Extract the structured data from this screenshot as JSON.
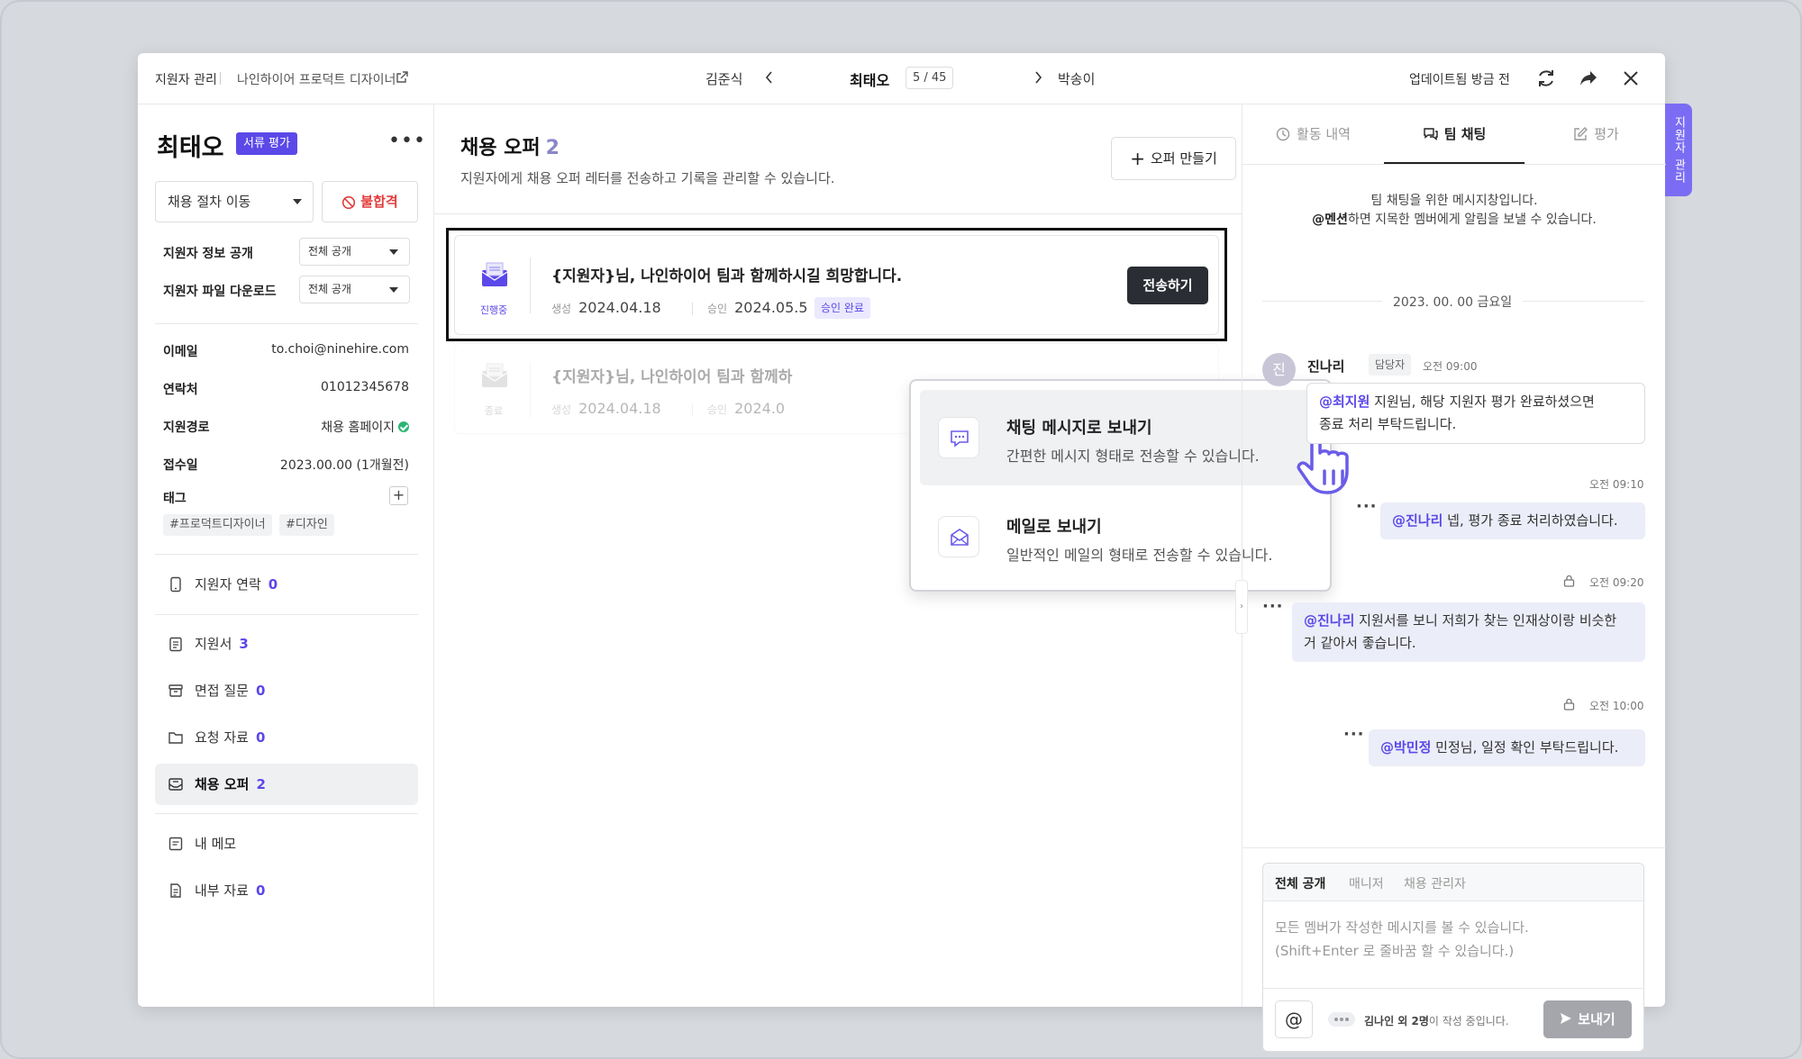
{
  "topbar": {
    "breadcrumb_section": "지원자 관리",
    "breadcrumb_job": "나인하이어 프로덕트 디자이너",
    "prev_candidate": "김준식",
    "current_candidate": "최태오",
    "pager": "5 / 45",
    "next_candidate": "박송이",
    "updated_text": "업데이트됨 방금 전"
  },
  "side_tab": "지원자 관리",
  "candidate": {
    "name": "최태오",
    "stage": "서류 평가",
    "move_stage_label": "채용 절차 이동",
    "reject_label": "불합격",
    "info_disclosure_label": "지원자 정보 공개",
    "info_disclosure_value": "전체 공개",
    "file_download_label": "지원자 파일 다운로드",
    "file_download_value": "전체 공개",
    "email_label": "이메일",
    "email": "to.choi@ninehire.com",
    "phone_label": "연락처",
    "phone": "01012345678",
    "source_label": "지원경로",
    "source": "채용 홈페이지",
    "received_label": "접수일",
    "received": "2023.00.00 (1개월전)",
    "tags_label": "태그",
    "tags": [
      "#프로덕트디자이너",
      "#디자인"
    ]
  },
  "menu": [
    {
      "label": "지원자 연락",
      "count": "0"
    },
    {
      "label": "지원서",
      "count": "3"
    },
    {
      "label": "면접 질문",
      "count": "0"
    },
    {
      "label": "요청 자료",
      "count": "0"
    },
    {
      "label": "채용 오퍼",
      "count": "2"
    },
    {
      "label": "내 메모",
      "count": ""
    },
    {
      "label": "내부 자료",
      "count": "0"
    }
  ],
  "offers": {
    "title": "채용 오퍼",
    "count": "2",
    "description": "지원자에게 채용 오퍼 레터를 전송하고 기록을 관리할 수 있습니다.",
    "create_label": "오퍼 만들기",
    "items": [
      {
        "status": "진행중",
        "title": "{지원자}님, 나인하이어 팀과 함께하시길 희망합니다.",
        "created_label": "생성",
        "created": "2024.04.18",
        "approved_label": "승인",
        "approved": "2024.05.5",
        "badge": "승인 완료",
        "send_label": "전송하기"
      },
      {
        "status": "종료",
        "title": "{지원자}님, 나인하이어 팀과 함께하",
        "created_label": "생성",
        "created": "2024.04.18",
        "approved_label": "승인",
        "approved": "2024.0"
      }
    ]
  },
  "send_popup": [
    {
      "title": "채팅 메시지로 보내기",
      "desc": "간편한 메시지 형태로 전송할 수 있습니다."
    },
    {
      "title": "메일로 보내기",
      "desc": "일반적인 메일의 형태로 전송할 수 있습니다."
    }
  ],
  "right_tabs": [
    "활동 내역",
    "팀 채팅",
    "평가"
  ],
  "chat": {
    "notice_line1": "팀 채팅을 위한 메시지창입니다.",
    "notice_mention": "@멘션",
    "notice_line2": "하면 지목한 멤버에게 알림을 보낼 수 있습니다.",
    "date": "2023. 00. 00 금요일",
    "avatar_initial": "진",
    "author": "진나리",
    "author_role": "담당자",
    "messages": [
      {
        "time": "오전 09:00",
        "mention": "@최지원",
        "text": " 지원님, 해당 지원자 평가 완료하셨으면",
        "text2": "종료 처리 부탁드립니다."
      },
      {
        "time": "오전 09:10",
        "mention": "@진나리",
        "text": " 넵, 평가 종료 처리하였습니다."
      },
      {
        "time": "오전 09:20",
        "mention": "@진나리",
        "text": " 지원서를 보니 저희가 찾는 인재상이랑 비슷한",
        "text2": "거 같아서 좋습니다."
      },
      {
        "time": "오전 10:00",
        "mention": "@박민정",
        "text": " 민정님, 일정 확인 부탁드립니다."
      }
    ]
  },
  "composer": {
    "tabs": [
      "전체 공개",
      "매니저",
      "채용 관리자"
    ],
    "placeholder_line1": "모든 멤버가 작성한 메시지를 볼 수 있습니다.",
    "placeholder_line2": "(Shift+Enter 로 줄바꿈 할 수 있습니다.)",
    "at_label": "@",
    "typing_names": "김나인 외 2명",
    "typing_suffix": "이 작성 중입니다.",
    "send_label": "보내기"
  },
  "colors": {
    "accent": "#5b48e8",
    "side_tab": "#7b6df3",
    "danger": "#e23b3b",
    "success": "#2bb673",
    "dark_button": "#2a2d33"
  }
}
